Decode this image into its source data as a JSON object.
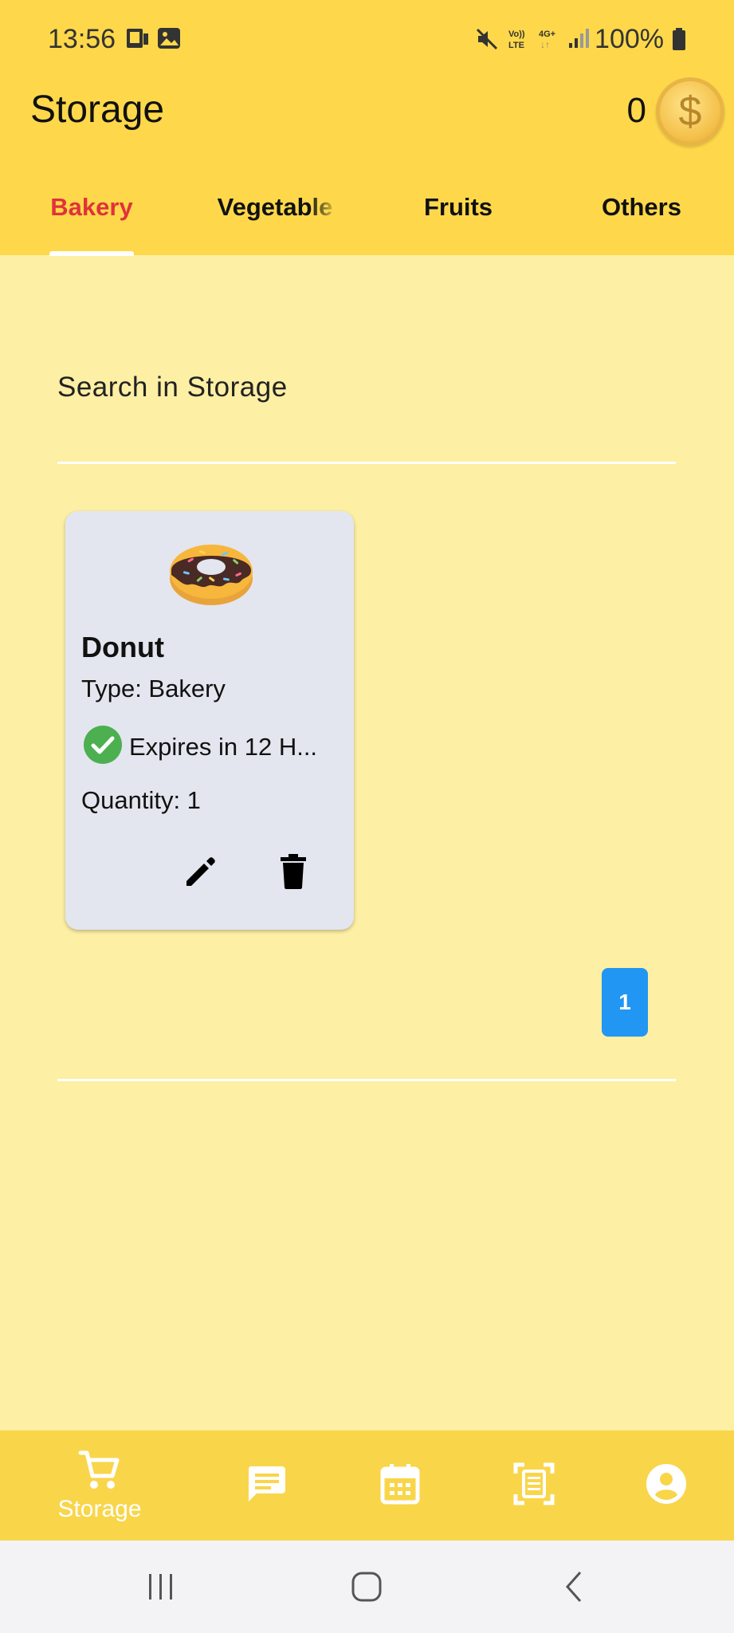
{
  "status_bar": {
    "time": "13:56",
    "battery": "100%"
  },
  "app_bar": {
    "title": "Storage",
    "coin_count": "0",
    "coin_symbol": "$"
  },
  "tabs": [
    {
      "label": "Bakery",
      "active": true
    },
    {
      "label": "Vegetable",
      "active": false
    },
    {
      "label": "Fruits",
      "active": false
    },
    {
      "label": "Others",
      "active": false
    }
  ],
  "search": {
    "placeholder": "Search in Storage"
  },
  "items": [
    {
      "emoji": "🍩",
      "name": "Donut",
      "type_text": "Type: Bakery",
      "expiry_text": "Expires in 12 H...",
      "quantity_text": "Quantity: 1"
    }
  ],
  "pagination": {
    "current_page": "1"
  },
  "bottom_nav": [
    {
      "icon": "cart-icon",
      "label": "Storage",
      "active": true
    },
    {
      "icon": "chat-icon",
      "label": "",
      "active": false
    },
    {
      "icon": "calendar-icon",
      "label": "",
      "active": false
    },
    {
      "icon": "scan-icon",
      "label": "",
      "active": false
    },
    {
      "icon": "account-icon",
      "label": "",
      "active": false
    }
  ],
  "colors": {
    "app_bar": "#fed84a",
    "background": "#fdefa4",
    "active_tab": "#e0323b",
    "card": "#e3e6ee",
    "page_button": "#2196f3",
    "expiry_ok": "#4caf50"
  }
}
